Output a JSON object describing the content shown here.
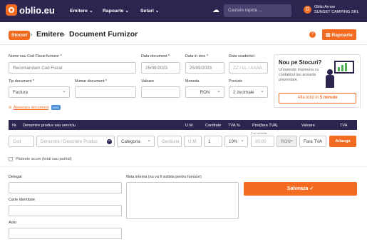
{
  "nav": {
    "logo": "oblio.eu",
    "items": [
      "Emitere",
      "Rapoarte",
      "Setari"
    ],
    "search_placeholder": "Cautare rapida ...",
    "user": {
      "name": "Oblio Arrow",
      "company": "SUNSET CAMPING SRL",
      "initial": "O"
    }
  },
  "header": {
    "breadcrumb_root": "Stocuri",
    "crumb1": "Emitere",
    "crumb2": "Document Furnizor",
    "reports_button": "Rapoarte",
    "help": "?"
  },
  "form": {
    "supplier": {
      "label": "Nume sau Cod Fiscal furnizor *",
      "value": "Recomandam Cod Fiscal"
    },
    "doc_date": {
      "label": "Data document *",
      "value": "25/09/2023"
    },
    "stock_date": {
      "label": "Data in stoc *",
      "value": "25/09/2023"
    },
    "due_date": {
      "label": "Data scadentei",
      "placeholder": "ZZ / LL / AAAA"
    },
    "doc_type": {
      "label": "Tip document *",
      "value": "Factura"
    },
    "doc_number": {
      "label": "Numar document *",
      "value": ""
    },
    "value": {
      "label": "Valoare",
      "value": ""
    },
    "currency": {
      "label": "Moneda",
      "value": "RON"
    },
    "precision": {
      "label": "Precizie",
      "value": "2 zecimale"
    },
    "attach": {
      "label": "Ataseaza document",
      "badge": "NOU"
    }
  },
  "promo": {
    "title": "Nou pe Stocuri?",
    "text": "Urmareste impreuna cu contabilul tau aceasta prezentare.",
    "button_prefix": "Afla totul in",
    "button_highlight": "5 minute"
  },
  "table": {
    "headers": [
      "Nr.",
      "Denumire produs sau serviciu",
      "U.M.",
      "Cantitate",
      "TVA %",
      "Pret(fara TVA)",
      "Valoare",
      "TVA"
    ],
    "row": {
      "code_placeholder": "Cod",
      "name_placeholder": "Denumire / Descriere Produs",
      "category": "Categoria",
      "warehouse_placeholder": "Gestiune",
      "um_placeholder": "U.M.",
      "quantity": "1",
      "vat": "19%",
      "price_note": "Pret achizitie",
      "price_placeholder": "00.00",
      "currency": "RON",
      "vat_mode": "Fara TVA",
      "add_button": "Adauga"
    },
    "paid_label": "Plateste acum (total sau partial)"
  },
  "bottom": {
    "delegate": "Delegat",
    "id_card": "Carte Identitate",
    "car": "Auto",
    "note": "Nota interna (nu va fi vizibila pentru furnizor)",
    "save": "Salveaza"
  },
  "colors": {
    "nav": "#2d2450",
    "accent": "#f26b21",
    "table_header": "#2d2450"
  }
}
